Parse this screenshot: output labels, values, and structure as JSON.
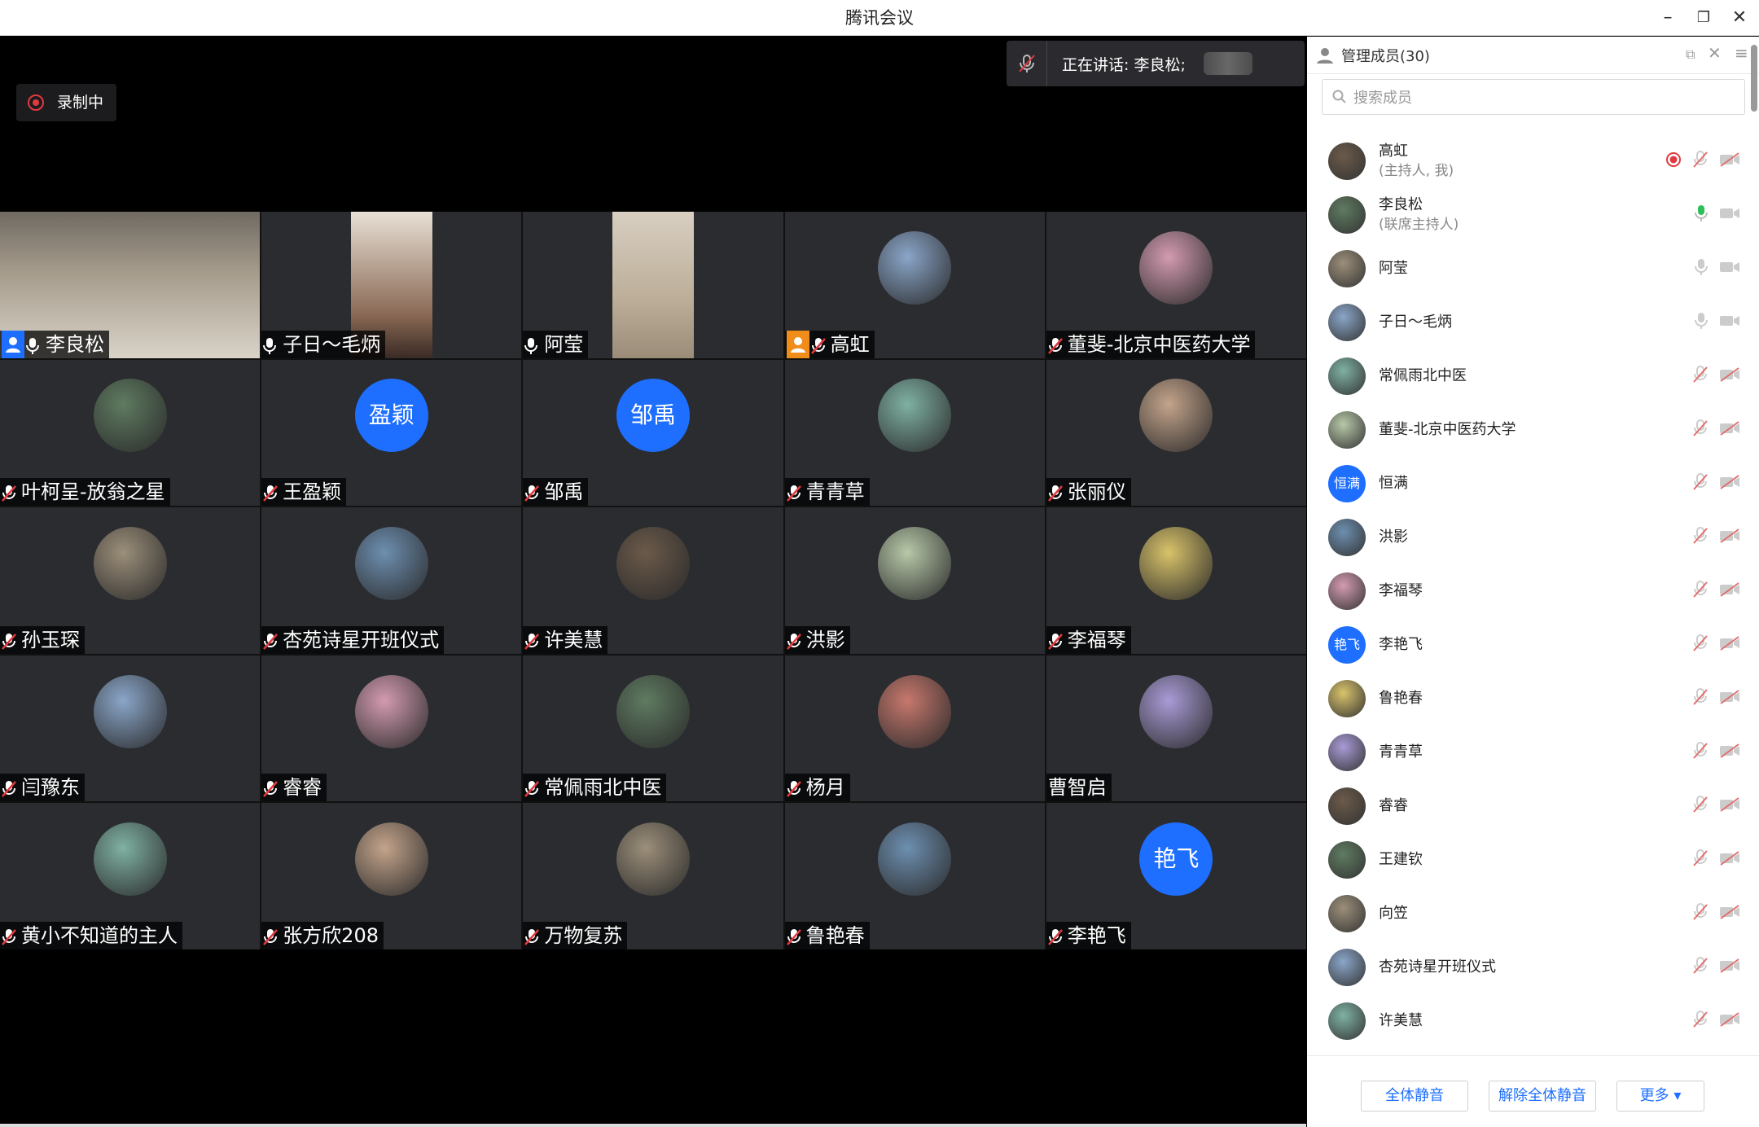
{
  "window": {
    "title": "腾讯会议"
  },
  "recording": {
    "label": "录制中"
  },
  "speaking": {
    "label": "正在讲话: 李良松;"
  },
  "tiles": [
    {
      "name": "李良松",
      "kind": "video",
      "active": true,
      "host": "blue",
      "mic": "on"
    },
    {
      "name": "子日～毛炳",
      "kind": "video",
      "mic": "on"
    },
    {
      "name": "阿莹",
      "kind": "video",
      "mic": "on"
    },
    {
      "name": "高虹",
      "kind": "avatar",
      "host": "orange",
      "mic": "muted"
    },
    {
      "name": "董斐-北京中医药大学",
      "kind": "avatar",
      "mic": "muted"
    },
    {
      "name": "叶柯呈-放翁之星",
      "kind": "avatar",
      "mic": "muted"
    },
    {
      "name": "王盈颖",
      "kind": "text",
      "avatar_text": "盈颖",
      "mic": "muted"
    },
    {
      "name": "邹禹",
      "kind": "text",
      "avatar_text": "邹禹",
      "mic": "muted"
    },
    {
      "name": "青青草",
      "kind": "avatar",
      "mic": "muted"
    },
    {
      "name": "张丽仪",
      "kind": "avatar",
      "mic": "muted"
    },
    {
      "name": "孙玉琛",
      "kind": "avatar",
      "mic": "muted"
    },
    {
      "name": "杏苑诗星开班仪式",
      "kind": "avatar",
      "mic": "muted"
    },
    {
      "name": "许美慧",
      "kind": "avatar",
      "mic": "muted"
    },
    {
      "name": "洪影",
      "kind": "avatar",
      "mic": "muted"
    },
    {
      "name": "李福琴",
      "kind": "avatar",
      "mic": "muted"
    },
    {
      "name": "闫豫东",
      "kind": "avatar",
      "mic": "muted"
    },
    {
      "name": "睿睿",
      "kind": "avatar",
      "mic": "muted"
    },
    {
      "name": "常佩雨北中医",
      "kind": "avatar",
      "mic": "muted"
    },
    {
      "name": "杨月",
      "kind": "avatar",
      "mic": "muted"
    },
    {
      "name": "曹智启",
      "kind": "avatar",
      "mic": "none"
    },
    {
      "name": "黄小不知道的主人",
      "kind": "avatar",
      "mic": "muted"
    },
    {
      "name": "张方欣208",
      "kind": "avatar",
      "mic": "muted"
    },
    {
      "name": "万物复苏",
      "kind": "avatar",
      "mic": "muted"
    },
    {
      "name": "鲁艳春",
      "kind": "avatar",
      "mic": "muted"
    },
    {
      "name": "李艳飞",
      "kind": "text",
      "avatar_text": "艳飞",
      "mic": "muted"
    }
  ],
  "panel": {
    "title": "管理成员(30)",
    "search_placeholder": "搜索成员",
    "members": [
      {
        "name": "高虹",
        "role": "(主持人, 我)",
        "status": "recording"
      },
      {
        "name": "李良松",
        "role": "(联席主持人)",
        "status": "speaking"
      },
      {
        "name": "阿莹",
        "role": "",
        "status": "mic"
      },
      {
        "name": "子日～毛炳",
        "role": "",
        "status": "mic"
      },
      {
        "name": "常佩雨北中医",
        "role": "",
        "status": "muted"
      },
      {
        "name": "董斐-北京中医药大学",
        "role": "",
        "status": "muted"
      },
      {
        "name": "恒满",
        "role": "",
        "status": "muted",
        "avatar_text": "恒满"
      },
      {
        "name": "洪影",
        "role": "",
        "status": "muted"
      },
      {
        "name": "李福琴",
        "role": "",
        "status": "muted"
      },
      {
        "name": "李艳飞",
        "role": "",
        "status": "muted",
        "avatar_text": "艳飞"
      },
      {
        "name": "鲁艳春",
        "role": "",
        "status": "muted"
      },
      {
        "name": "青青草",
        "role": "",
        "status": "muted"
      },
      {
        "name": "睿睿",
        "role": "",
        "status": "muted"
      },
      {
        "name": "王建钦",
        "role": "",
        "status": "muted"
      },
      {
        "name": "向笠",
        "role": "",
        "status": "muted"
      },
      {
        "name": "杏苑诗星开班仪式",
        "role": "",
        "status": "muted"
      },
      {
        "name": "许美慧",
        "role": "",
        "status": "muted"
      }
    ],
    "footer": {
      "mute_all": "全体静音",
      "unmute_all": "解除全体静音",
      "more": "更多"
    }
  },
  "colors": {
    "accent": "#1e6fff",
    "active_border": "#2dbf5a",
    "record_red": "#e0393e",
    "host_orange": "#f08c1a"
  }
}
